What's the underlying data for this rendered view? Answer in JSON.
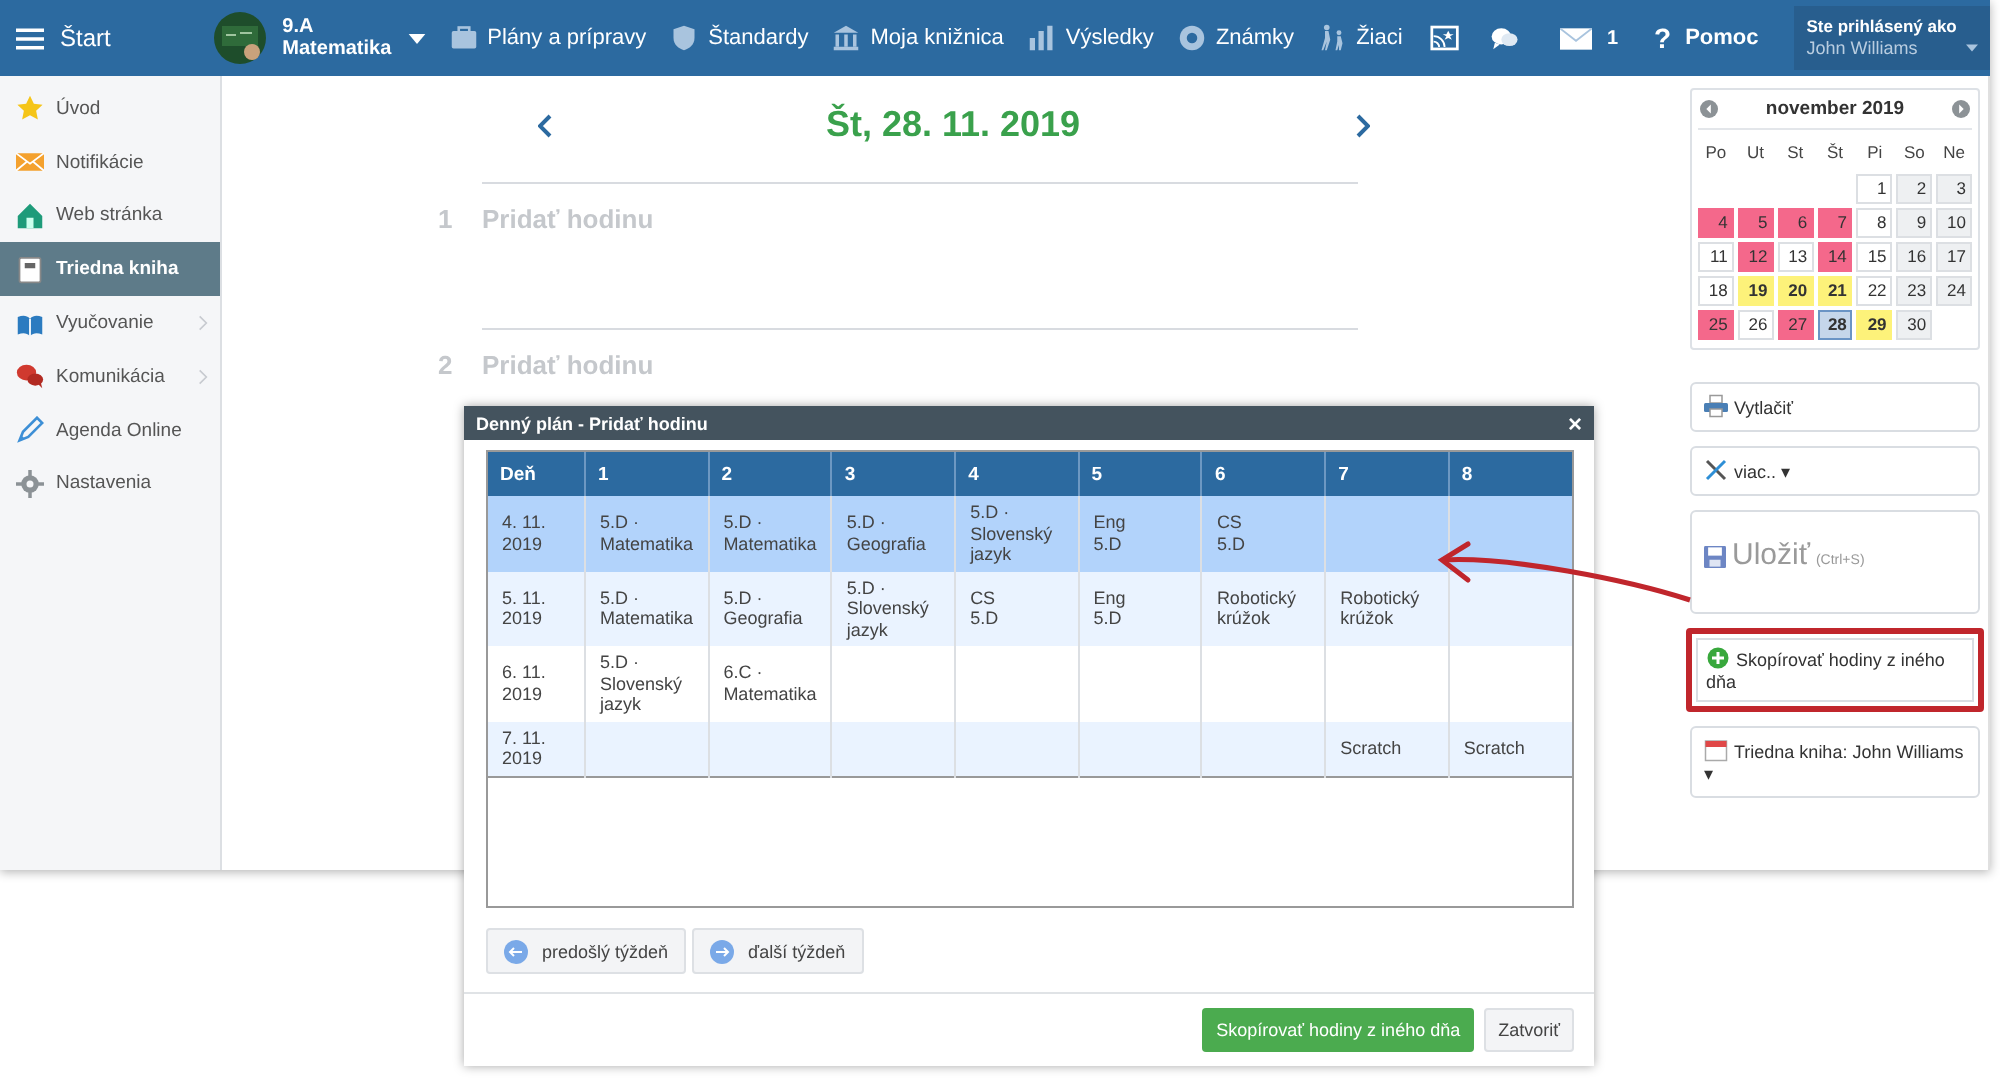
{
  "topbar": {
    "home": "Štart",
    "class_name": "9.A",
    "subject": "Matematika",
    "nav": [
      "Plány a prípravy",
      "Štandardy",
      "Moja knižnica",
      "Výsledky",
      "Známky",
      "Žiaci"
    ],
    "mail_count": "1",
    "help_mark": "?",
    "help": "Pomoc",
    "user_caption": "Ste prihlásený ako",
    "user_name": "John Williams"
  },
  "sidebar": {
    "items": [
      {
        "label": "Úvod",
        "selected": false,
        "expandable": false
      },
      {
        "label": "Notifikácie",
        "selected": false,
        "expandable": false
      },
      {
        "label": "Web stránka",
        "selected": false,
        "expandable": false
      },
      {
        "label": "Triedna kniha",
        "selected": true,
        "expandable": false
      },
      {
        "label": "Vyučovanie",
        "selected": false,
        "expandable": true
      },
      {
        "label": "Komunikácia",
        "selected": false,
        "expandable": true
      },
      {
        "label": "Agenda Online",
        "selected": false,
        "expandable": false
      },
      {
        "label": "Nastavenia",
        "selected": false,
        "expandable": false
      }
    ]
  },
  "day": {
    "title": "Št, 28. 11. 2019",
    "lessons": [
      {
        "number": "1",
        "label": "Pridať hodinu"
      },
      {
        "number": "2",
        "label": "Pridať hodinu"
      }
    ]
  },
  "calendar": {
    "title": "november 2019",
    "weekdays": [
      "Po",
      "Ut",
      "St",
      "Št",
      "Pi",
      "So",
      "Ne"
    ],
    "weeks": [
      [
        {
          "kind": "blank"
        },
        {
          "kind": "blank"
        },
        {
          "kind": "blank"
        },
        {
          "kind": "blank"
        },
        {
          "day": "1",
          "kind": "normal",
          "selected": false
        },
        {
          "day": "2",
          "kind": "weekend",
          "selected": false
        },
        {
          "day": "3",
          "kind": "weekend",
          "selected": false
        }
      ],
      [
        {
          "day": "4",
          "kind": "red",
          "selected": false
        },
        {
          "day": "5",
          "kind": "red",
          "selected": false
        },
        {
          "day": "6",
          "kind": "red",
          "selected": false
        },
        {
          "day": "7",
          "kind": "red",
          "selected": false
        },
        {
          "day": "8",
          "kind": "normal",
          "selected": false
        },
        {
          "day": "9",
          "kind": "weekend",
          "selected": false
        },
        {
          "day": "10",
          "kind": "weekend",
          "selected": false
        }
      ],
      [
        {
          "day": "11",
          "kind": "normal",
          "selected": false
        },
        {
          "day": "12",
          "kind": "red",
          "selected": false
        },
        {
          "day": "13",
          "kind": "normal",
          "selected": false
        },
        {
          "day": "14",
          "kind": "red",
          "selected": false
        },
        {
          "day": "15",
          "kind": "normal",
          "selected": false
        },
        {
          "day": "16",
          "kind": "weekend",
          "selected": false
        },
        {
          "day": "17",
          "kind": "weekend",
          "selected": false
        }
      ],
      [
        {
          "day": "18",
          "kind": "normal",
          "selected": false
        },
        {
          "day": "19",
          "kind": "yellow",
          "selected": false
        },
        {
          "day": "20",
          "kind": "yellow",
          "selected": false
        },
        {
          "day": "21",
          "kind": "yellow",
          "selected": false
        },
        {
          "day": "22",
          "kind": "normal",
          "selected": false
        },
        {
          "day": "23",
          "kind": "weekend",
          "selected": false
        },
        {
          "day": "24",
          "kind": "weekend",
          "selected": false
        }
      ],
      [
        {
          "day": "25",
          "kind": "red",
          "selected": false
        },
        {
          "day": "26",
          "kind": "normal",
          "selected": false
        },
        {
          "day": "27",
          "kind": "red",
          "selected": false
        },
        {
          "day": "28",
          "kind": "normal",
          "selected": true
        },
        {
          "day": "29",
          "kind": "yellow",
          "selected": false
        },
        {
          "day": "30",
          "kind": "weekend",
          "selected": false
        },
        {
          "kind": "blank"
        }
      ]
    ]
  },
  "actions": [
    {
      "kind": "print",
      "label": "Vytlačiť",
      "highlighted": false
    },
    {
      "kind": "more",
      "label": "viac.. ▾",
      "highlighted": false
    },
    {
      "kind": "save",
      "label": "Uložiť",
      "hint": "(Ctrl+S)",
      "highlighted": false
    },
    {
      "kind": "copy",
      "label": "Skopírovať hodiny z iného dňa",
      "highlighted": true
    },
    {
      "kind": "book",
      "label": "Triedna kniha: John Williams ▾",
      "highlighted": false
    }
  ],
  "dialog": {
    "title": "Denný plán - Pridať hodinu",
    "close": "×",
    "columns": [
      "Deň",
      "1",
      "2",
      "3",
      "4",
      "5",
      "6",
      "7",
      "8"
    ],
    "rows": [
      {
        "selected": true,
        "cells": [
          "4. 11.\n2019",
          "5.D ·\nMatematika",
          "5.D ·\nMatematika",
          "5.D ·\nGeografia",
          "5.D ·\nSlovenský\njazyk",
          "Eng\n5.D",
          "CS\n5.D",
          "",
          ""
        ]
      },
      {
        "selected": false,
        "cells": [
          "5. 11.\n2019",
          "5.D ·\nMatematika",
          "5.D ·\nGeografia",
          "5.D ·\nSlovenský\njazyk",
          "CS\n5.D",
          "Eng\n5.D",
          "Robotický\nkrúžok",
          "Robotický\nkrúžok",
          ""
        ]
      },
      {
        "selected": false,
        "cells": [
          "6. 11.\n2019",
          "5.D ·\nSlovenský\njazyk",
          "6.C ·\nMatematika",
          "",
          "",
          "",
          "",
          "",
          ""
        ]
      },
      {
        "selected": false,
        "cells": [
          "7. 11.\n2019",
          "",
          "",
          "",
          "",
          "",
          "",
          "Scratch",
          "Scratch"
        ]
      }
    ],
    "prev_week": "predošlý týždeň",
    "next_week": "ďalší týždeň",
    "confirm": "Skopírovať hodiny z iného dňa",
    "cancel": "Zatvoriť"
  }
}
